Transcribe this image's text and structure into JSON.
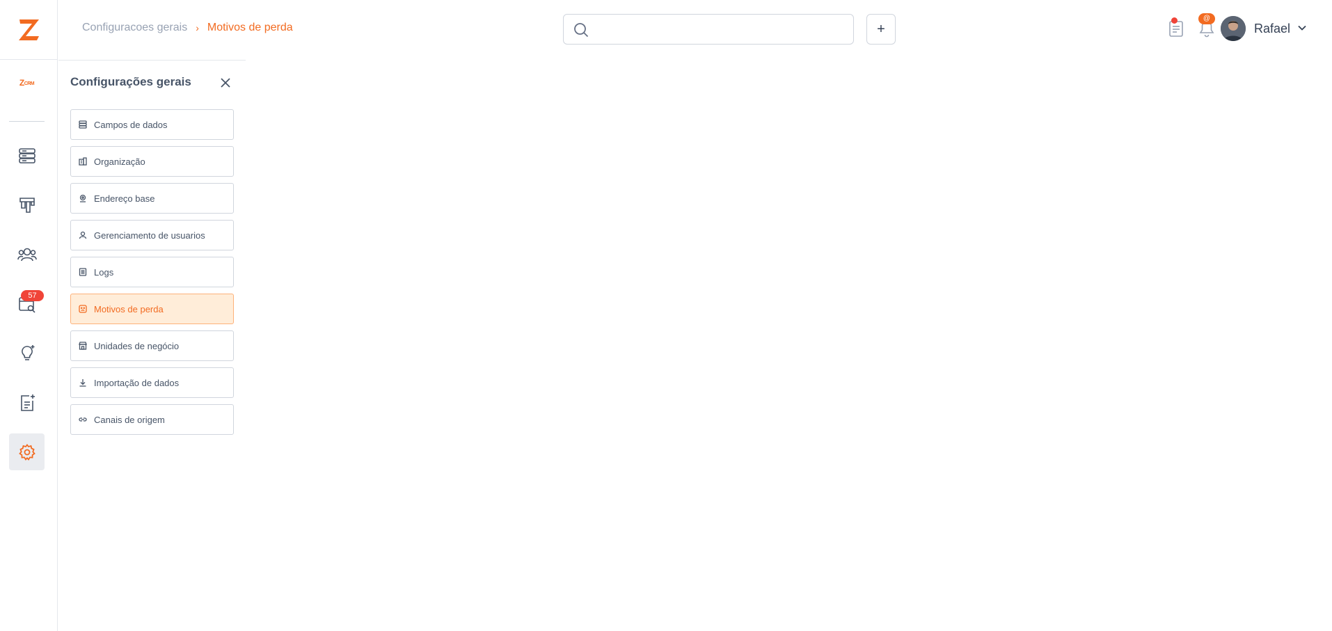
{
  "brand": {
    "crm_logo_letter": "Z",
    "crm_logo_suffix": "CRM",
    "accent": "#f26b21"
  },
  "breadcrumb": {
    "parent": "Configuracoes gerais",
    "separator": "›",
    "current": "Motivos de perda"
  },
  "search": {
    "placeholder": "",
    "value": ""
  },
  "header": {
    "add_label": "+",
    "mentions_badge": "@",
    "user_name": "Rafael"
  },
  "rail": {
    "items": [
      {
        "icon": "server-icon"
      },
      {
        "icon": "pipeline-icon"
      },
      {
        "icon": "users-icon"
      },
      {
        "icon": "calendar-search-icon",
        "badge": "57"
      },
      {
        "icon": "lightbulb-icon"
      },
      {
        "icon": "notes-icon"
      },
      {
        "icon": "gear-icon",
        "active": true
      }
    ]
  },
  "panel": {
    "title": "Configurações gerais",
    "items": [
      {
        "label": "Campos de dados",
        "icon": "database-icon"
      },
      {
        "label": "Organização",
        "icon": "building-icon"
      },
      {
        "label": "Endereço base",
        "icon": "location-icon"
      },
      {
        "label": "Gerenciamento de usuarios",
        "icon": "user-icon"
      },
      {
        "label": "Logs",
        "icon": "log-icon"
      },
      {
        "label": "Motivos de perda",
        "icon": "emoji-sad-icon",
        "active": true
      },
      {
        "label": "Unidades de negócio",
        "icon": "store-icon"
      },
      {
        "label": "Importação de dados",
        "icon": "download-icon"
      },
      {
        "label": "Canais de origem",
        "icon": "link-icon"
      }
    ]
  }
}
